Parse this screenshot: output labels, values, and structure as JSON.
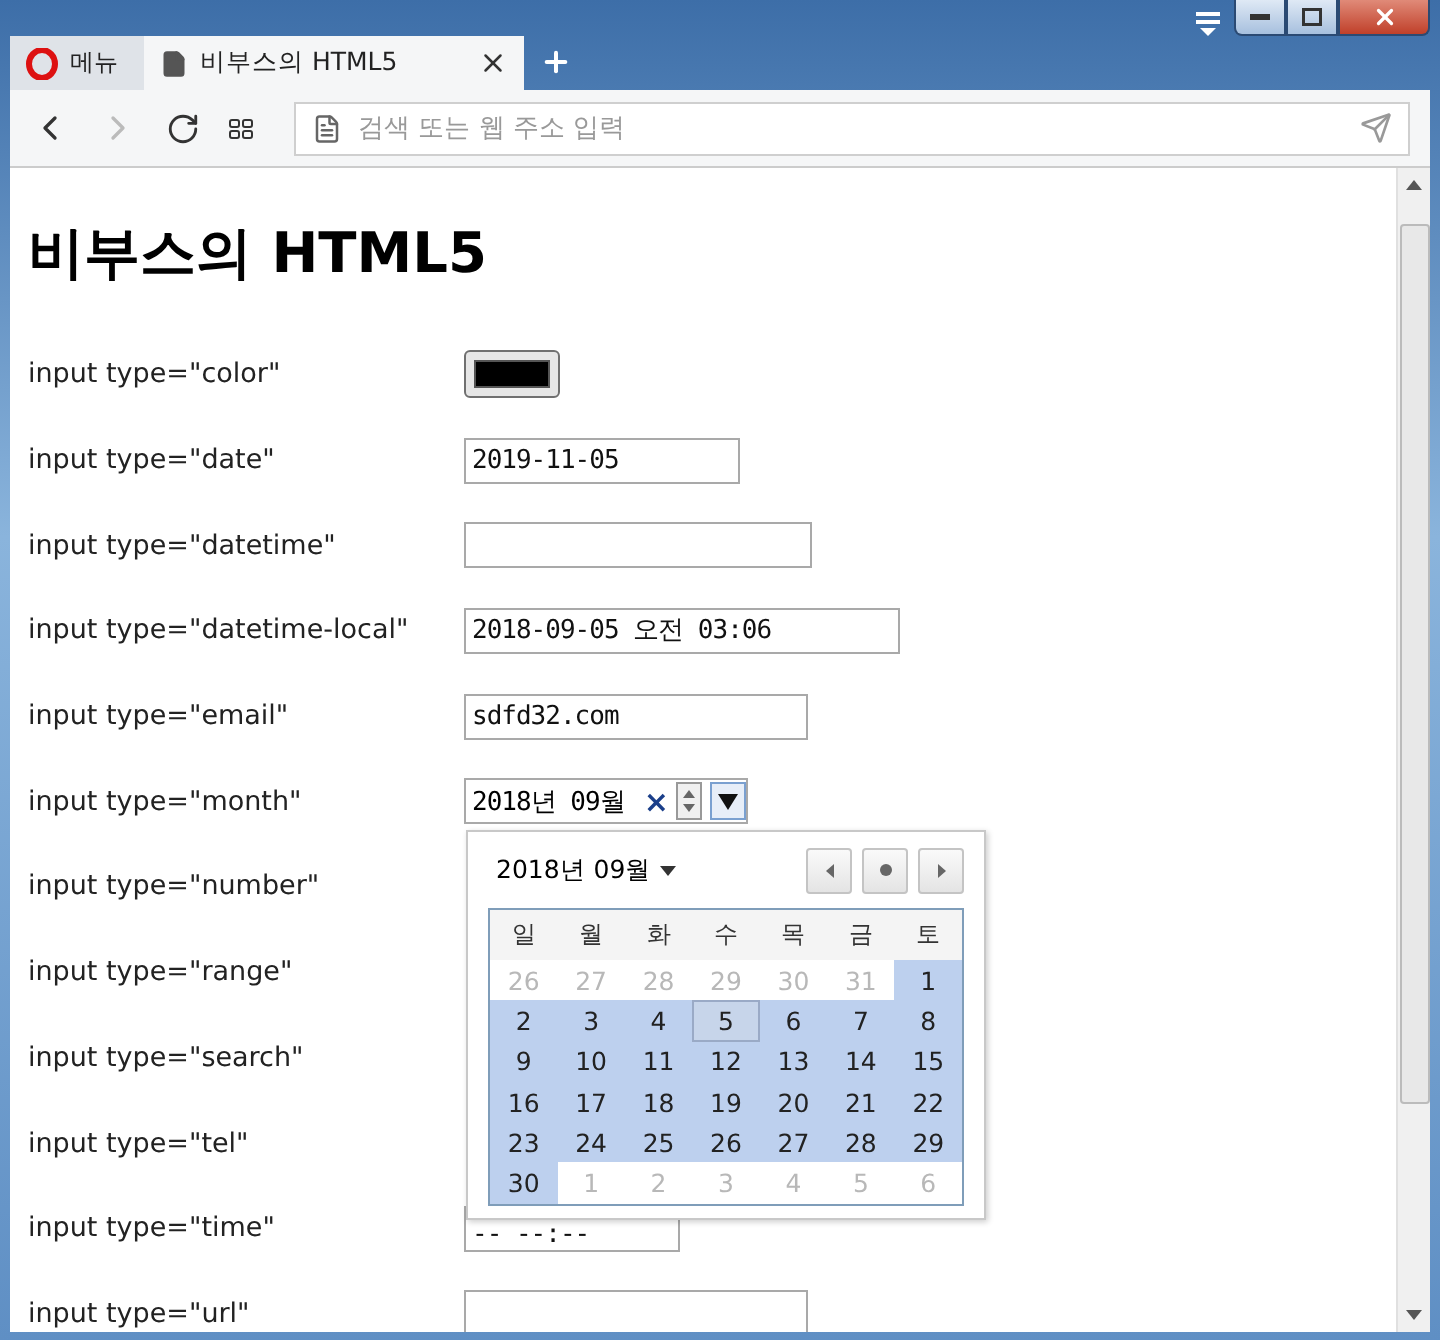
{
  "browser": {
    "menu_label": "메뉴",
    "tabs": [
      {
        "title": "비부스의 HTML5",
        "selected": true
      }
    ],
    "address": {
      "placeholder": "검색 또는 웹 주소 입력"
    }
  },
  "page": {
    "heading": "비부스의 HTML5",
    "rows": [
      {
        "label": "input type=\"color\"",
        "kind": "color"
      },
      {
        "label": "input type=\"date\"",
        "kind": "date",
        "value": "2019-11-05"
      },
      {
        "label": "input type=\"datetime\"",
        "kind": "datetime",
        "value": ""
      },
      {
        "label": "input type=\"datetime-local\"",
        "kind": "datetime_local",
        "value": "2018-09-05 오전 03:06"
      },
      {
        "label": "input type=\"email\"",
        "kind": "email",
        "value": "sdfd32.com"
      },
      {
        "label": "input type=\"month\"",
        "kind": "month",
        "value": "2018년 09월",
        "clear": "×"
      },
      {
        "label": "input type=\"number\"",
        "kind": "covered"
      },
      {
        "label": "input type=\"range\"",
        "kind": "covered"
      },
      {
        "label": "input type=\"search\"",
        "kind": "covered"
      },
      {
        "label": "input type=\"tel\"",
        "kind": "covered"
      },
      {
        "label": "input type=\"time\"",
        "kind": "time",
        "value": "-- --:--"
      },
      {
        "label": "input type=\"url\"",
        "kind": "url",
        "value": ""
      }
    ]
  },
  "picker": {
    "title": "2018년 09월",
    "weekdays": [
      "일",
      "월",
      "화",
      "수",
      "목",
      "금",
      "토"
    ],
    "weeks": [
      [
        {
          "day": "26",
          "in_month": false,
          "selected": false
        },
        {
          "day": "27",
          "in_month": false,
          "selected": false
        },
        {
          "day": "28",
          "in_month": false,
          "selected": false
        },
        {
          "day": "29",
          "in_month": false,
          "selected": false
        },
        {
          "day": "30",
          "in_month": false,
          "selected": false
        },
        {
          "day": "31",
          "in_month": false,
          "selected": false
        },
        {
          "day": "1",
          "in_month": true,
          "selected": false
        }
      ],
      [
        {
          "day": "2",
          "in_month": true,
          "selected": false
        },
        {
          "day": "3",
          "in_month": true,
          "selected": false
        },
        {
          "day": "4",
          "in_month": true,
          "selected": false
        },
        {
          "day": "5",
          "in_month": true,
          "selected": true
        },
        {
          "day": "6",
          "in_month": true,
          "selected": false
        },
        {
          "day": "7",
          "in_month": true,
          "selected": false
        },
        {
          "day": "8",
          "in_month": true,
          "selected": false
        }
      ],
      [
        {
          "day": "9",
          "in_month": true,
          "selected": false
        },
        {
          "day": "10",
          "in_month": true,
          "selected": false
        },
        {
          "day": "11",
          "in_month": true,
          "selected": false
        },
        {
          "day": "12",
          "in_month": true,
          "selected": false
        },
        {
          "day": "13",
          "in_month": true,
          "selected": false
        },
        {
          "day": "14",
          "in_month": true,
          "selected": false
        },
        {
          "day": "15",
          "in_month": true,
          "selected": false
        }
      ],
      [
        {
          "day": "16",
          "in_month": true,
          "selected": false
        },
        {
          "day": "17",
          "in_month": true,
          "selected": false
        },
        {
          "day": "18",
          "in_month": true,
          "selected": false
        },
        {
          "day": "19",
          "in_month": true,
          "selected": false
        },
        {
          "day": "20",
          "in_month": true,
          "selected": false
        },
        {
          "day": "21",
          "in_month": true,
          "selected": false
        },
        {
          "day": "22",
          "in_month": true,
          "selected": false
        }
      ],
      [
        {
          "day": "23",
          "in_month": true,
          "selected": false
        },
        {
          "day": "24",
          "in_month": true,
          "selected": false
        },
        {
          "day": "25",
          "in_month": true,
          "selected": false
        },
        {
          "day": "26",
          "in_month": true,
          "selected": false
        },
        {
          "day": "27",
          "in_month": true,
          "selected": false
        },
        {
          "day": "28",
          "in_month": true,
          "selected": false
        },
        {
          "day": "29",
          "in_month": true,
          "selected": false
        }
      ],
      [
        {
          "day": "30",
          "in_month": true,
          "selected": false
        },
        {
          "day": "1",
          "in_month": false,
          "selected": false
        },
        {
          "day": "2",
          "in_month": false,
          "selected": false
        },
        {
          "day": "3",
          "in_month": false,
          "selected": false
        },
        {
          "day": "4",
          "in_month": false,
          "selected": false
        },
        {
          "day": "5",
          "in_month": false,
          "selected": false
        },
        {
          "day": "6",
          "in_month": false,
          "selected": false
        }
      ]
    ]
  }
}
